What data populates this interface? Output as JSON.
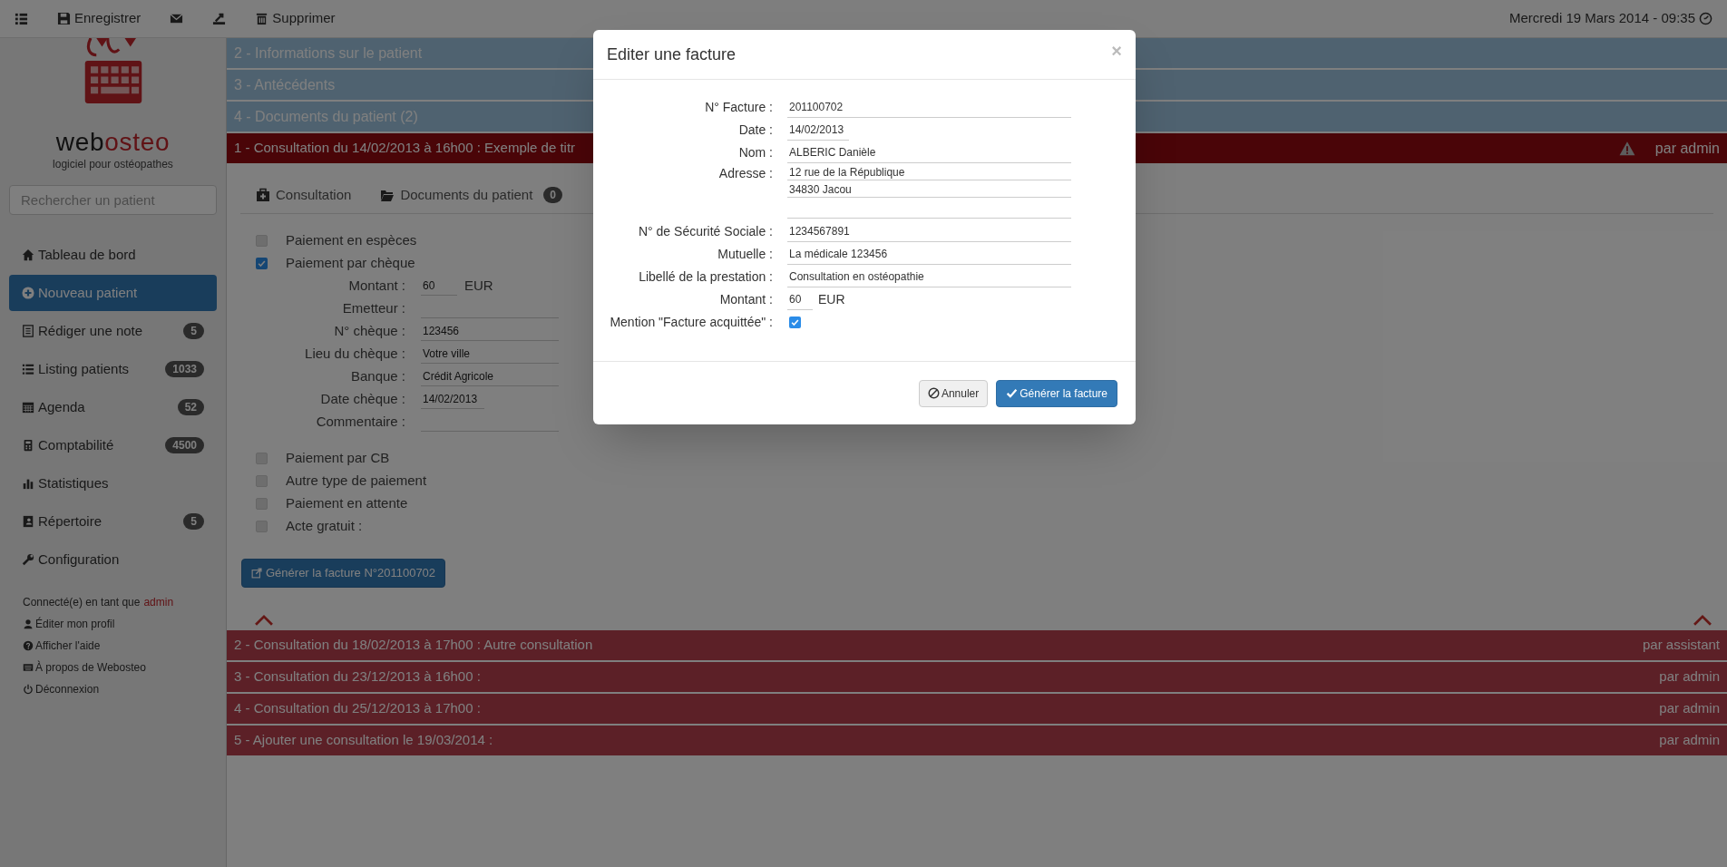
{
  "toolbar": {
    "save_label": "Enregistrer",
    "delete_label": "Supprimer",
    "datetime": "Mercredi 19 Mars 2014 - 09:35"
  },
  "sidebar": {
    "brand": {
      "part_1": "web",
      "part_2": "osteo"
    },
    "tagline": "logiciel pour ostéopathes",
    "search_placeholder": "Rechercher un patient",
    "nav": [
      {
        "label": "Tableau de bord",
        "selected": false
      },
      {
        "label": "Nouveau patient",
        "selected": true
      },
      {
        "label": "Rédiger une note",
        "badge": "5",
        "selected": false
      },
      {
        "label": "Listing patients",
        "badge": "1033",
        "selected": false
      },
      {
        "label": "Agenda",
        "badge": "52",
        "selected": false
      },
      {
        "label": "Comptabilité",
        "badge": "4500",
        "selected": false
      },
      {
        "label": "Statistiques",
        "selected": false
      },
      {
        "label": "Répertoire",
        "badge": "5",
        "selected": false
      },
      {
        "label": "Configuration",
        "selected": false
      }
    ],
    "connected_label": "Connecté(e) en tant que",
    "user": "admin",
    "links": [
      "Éditer mon profil",
      "Afficher l'aide",
      "À propos de Webosteo",
      "Déconnexion"
    ]
  },
  "main": {
    "sections_top": [
      "2 - Informations sur le patient",
      "3 - Antécédents",
      "4 - Documents du patient (2)"
    ],
    "current": {
      "title": "1 - Consultation du 14/02/2013 à 16h00 : Exemple de titr",
      "author": "par admin"
    },
    "tabs": [
      {
        "label": "Consultation"
      },
      {
        "label": "Documents du patient",
        "badge": "0"
      }
    ],
    "payments": [
      {
        "label": "Paiement en espèces",
        "checked": false
      },
      {
        "label": "Paiement par chèque",
        "checked": true,
        "fields": [
          {
            "kind": "amount",
            "label": "Montant :",
            "value": "60",
            "unit": "EUR"
          },
          {
            "kind": "text",
            "label": "Emetteur :"
          },
          {
            "kind": "text",
            "label": "N° chèque :",
            "value": "123456"
          },
          {
            "kind": "text",
            "label": "Lieu du chèque :",
            "value": "Votre ville"
          },
          {
            "kind": "text",
            "label": "Banque :",
            "value": "Crédit Agricole"
          },
          {
            "kind": "short",
            "label": "Date chèque :",
            "value": "14/02/2013"
          },
          {
            "kind": "text",
            "label": "Commentaire :"
          }
        ]
      },
      {
        "label": "Paiement par CB",
        "checked": false
      },
      {
        "label": "Autre type de paiement",
        "checked": false
      },
      {
        "label": "Paiement en attente",
        "checked": false
      },
      {
        "label": "Acte gratuit :",
        "checked": false
      }
    ],
    "generate_button": "Générer la facture N°201100702",
    "sections_bottom": [
      {
        "title": "2 - Consultation du 18/02/2013 à 17h00 : Autre consultation",
        "author": "par assistant"
      },
      {
        "title": "3 - Consultation du 23/12/2013 à 16h00 :",
        "author": "par admin"
      },
      {
        "title": "4 - Consultation du 25/12/2013 à 17h00 :",
        "author": "par admin"
      },
      {
        "title": "5 - Ajouter une consultation le 19/03/2014 :",
        "author": "par admin"
      }
    ]
  },
  "modal": {
    "title": "Editer une facture",
    "close": "×",
    "fields": [
      {
        "kind": "text",
        "label": "N° Facture :",
        "value": "201100702"
      },
      {
        "kind": "short",
        "label": "Date :",
        "value": "14/02/2013"
      },
      {
        "kind": "text",
        "label": "Nom :",
        "value": "ALBERIC Danièle"
      },
      {
        "kind": "address",
        "label": "Adresse :",
        "lines": [
          "12 rue de la République",
          "34830 Jacou"
        ]
      },
      {
        "kind": "text",
        "label": "N° de Sécurité Sociale :",
        "value": "1234567891"
      },
      {
        "kind": "text",
        "label": "Mutuelle :",
        "value": "La médicale 123456"
      },
      {
        "kind": "text",
        "label": "Libellé de la prestation :",
        "value": "Consultation en ostéopathie"
      },
      {
        "kind": "amount",
        "label": "Montant :",
        "value": "60",
        "unit": "EUR"
      }
    ],
    "paid_mention": {
      "label": "Mention \"Facture acquittée\" :",
      "checked": true
    },
    "cancel": "Annuler",
    "submit": "Générer la facture"
  }
}
